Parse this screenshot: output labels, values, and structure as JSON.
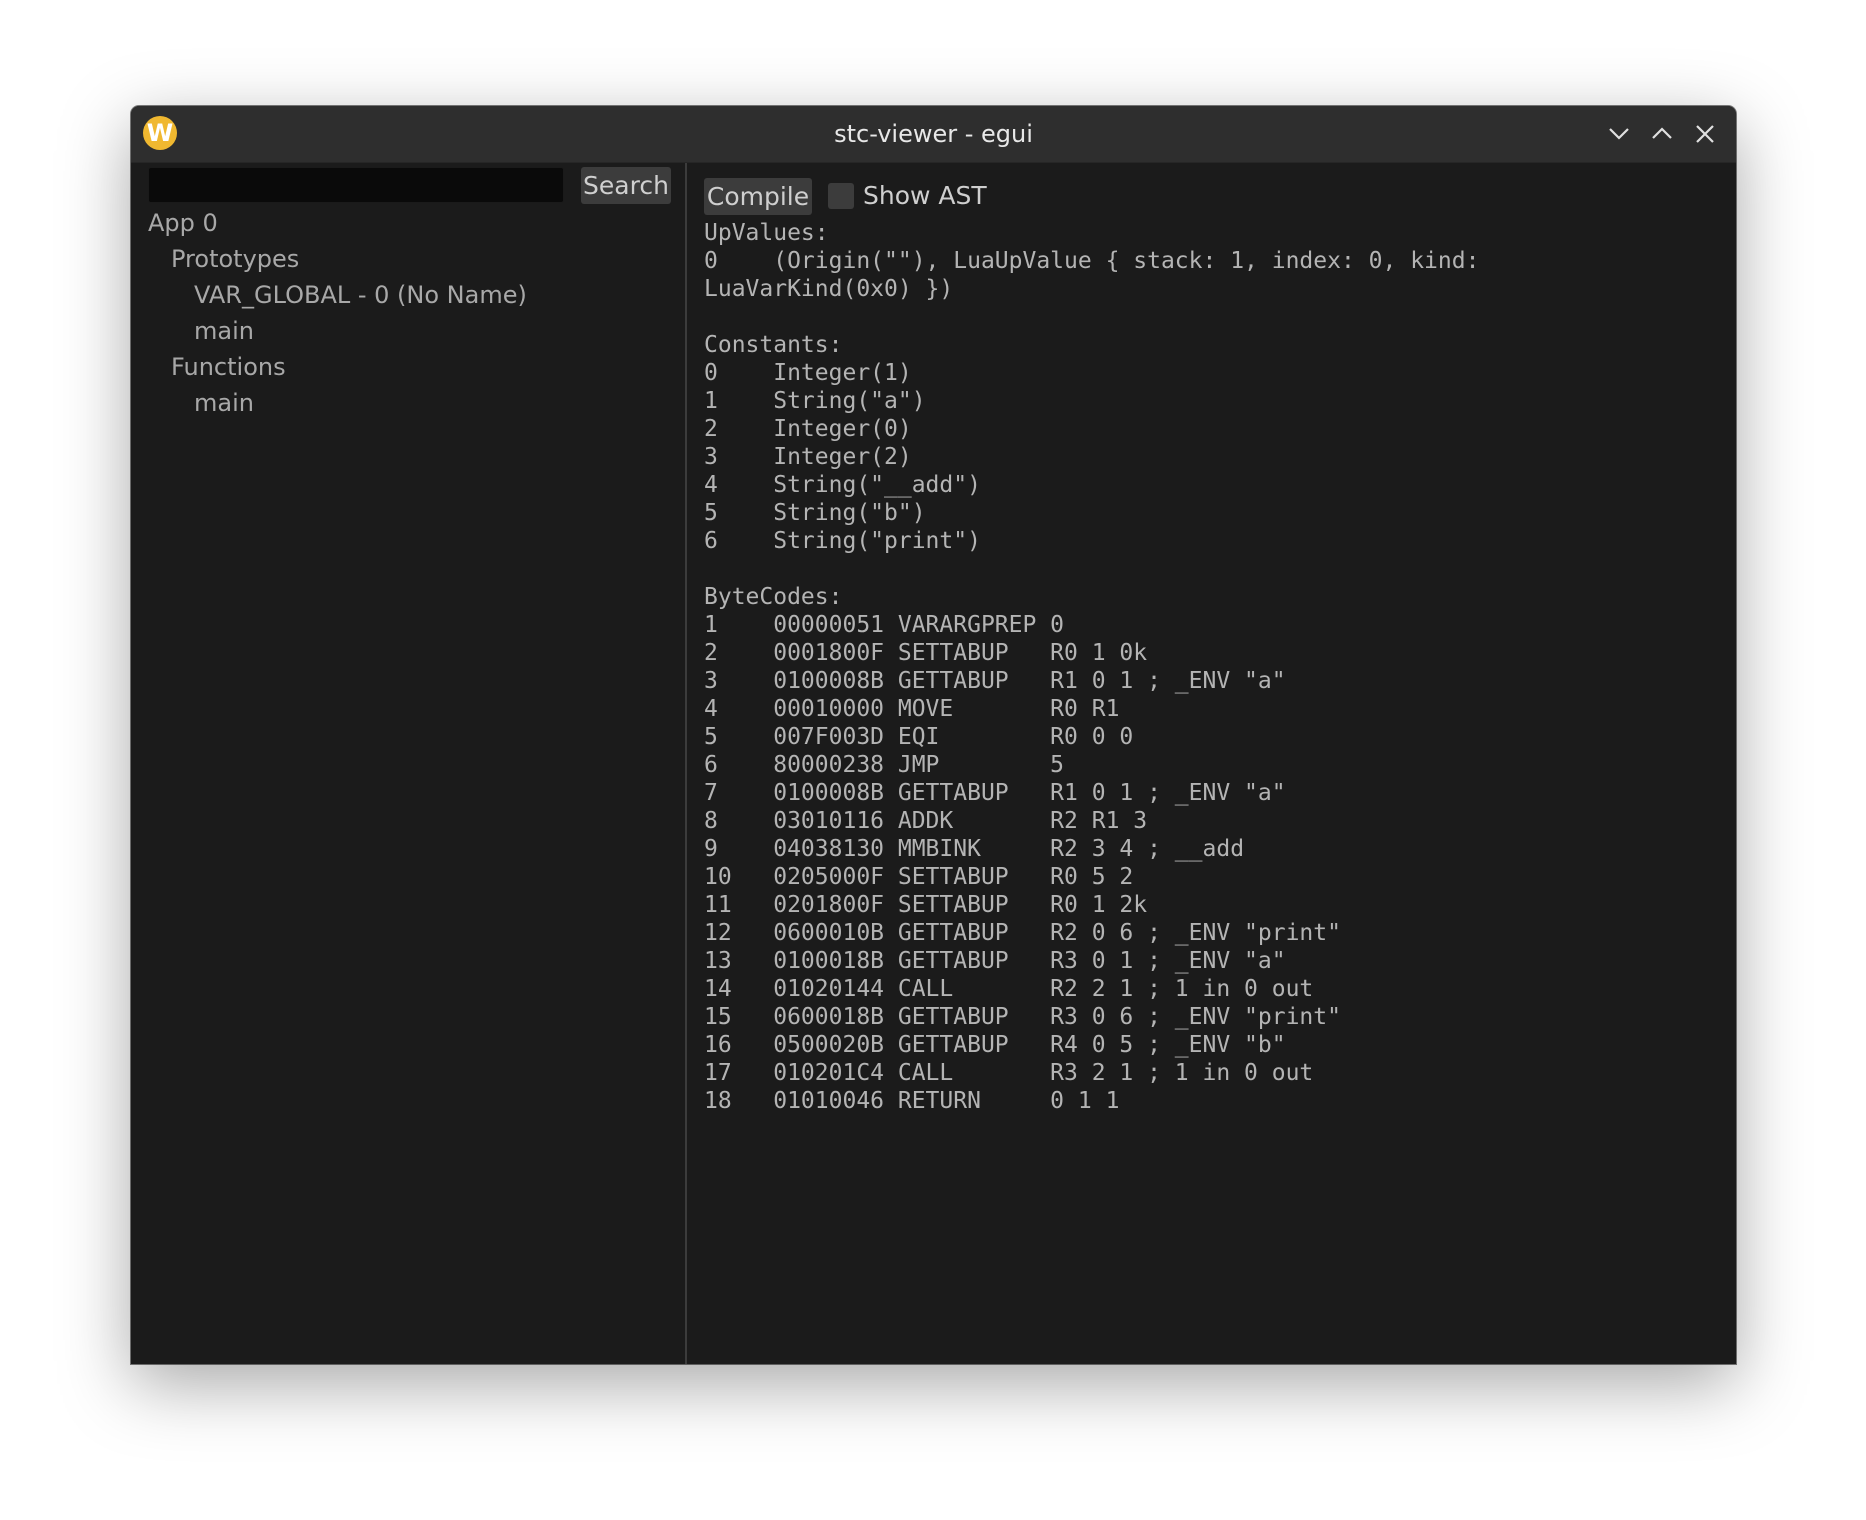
{
  "window": {
    "title": "stc-viewer - egui",
    "app_icon_letter": "W",
    "buttons": [
      "minimize",
      "maximize",
      "close"
    ]
  },
  "sidebar": {
    "search": {
      "value": "",
      "placeholder": "",
      "button_label": "Search"
    },
    "tree": {
      "app": "App 0",
      "prototypes_label": "Prototypes",
      "prototypes": [
        "VAR_GLOBAL - 0 (No Name)",
        "main"
      ],
      "functions_label": "Functions",
      "functions": [
        "main"
      ]
    }
  },
  "toolbar": {
    "compile_label": "Compile",
    "show_ast_label": "Show AST",
    "show_ast_checked": false
  },
  "output": {
    "text": "UpValues:\n0    (Origin(\"\"), LuaUpValue { stack: 1, index: 0, kind:\nLuaVarKind(0x0) })\n\nConstants:\n0    Integer(1)\n1    String(\"a\")\n2    Integer(0)\n3    Integer(2)\n4    String(\"__add\")\n5    String(\"b\")\n6    String(\"print\")\n\nByteCodes:\n1    00000051 VARARGPREP 0\n2    0001800F SETTABUP   R0 1 0k\n3    0100008B GETTABUP   R1 0 1 ; _ENV \"a\"\n4    00010000 MOVE       R0 R1\n5    007F003D EQI        R0 0 0\n6    80000238 JMP        5\n7    0100008B GETTABUP   R1 0 1 ; _ENV \"a\"\n8    03010116 ADDK       R2 R1 3\n9    04038130 MMBINK     R2 3 4 ; __add\n10   0205000F SETTABUP   R0 5 2\n11   0201800F SETTABUP   R0 1 2k\n12   0600010B GETTABUP   R2 0 6 ; _ENV \"print\"\n13   0100018B GETTABUP   R3 0 1 ; _ENV \"a\"\n14   01020144 CALL       R2 2 1 ; 1 in 0 out\n15   0600018B GETTABUP   R3 0 6 ; _ENV \"print\"\n16   0500020B GETTABUP   R4 0 5 ; _ENV \"b\"\n17   010201C4 CALL       R3 2 1 ; 1 in 0 out\n18   01010046 RETURN     0 1 1"
  },
  "colors": {
    "background": "#1b1b1b",
    "titlebar": "#2e2e2e",
    "button": "#3c3c3c",
    "text": "#b4b4b4",
    "app_icon": "#f0b830"
  }
}
